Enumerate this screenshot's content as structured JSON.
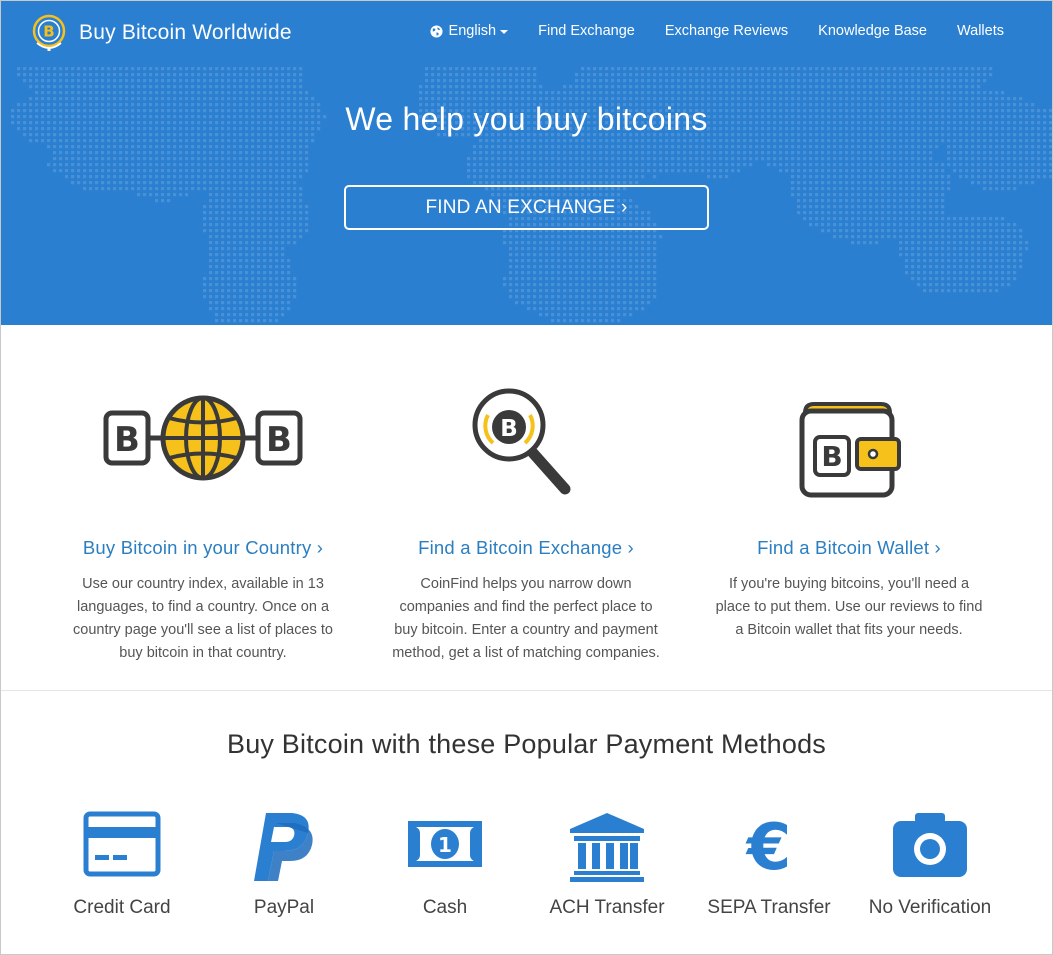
{
  "header": {
    "brand_name": "Buy Bitcoin Worldwide",
    "language": "English",
    "nav": [
      "Find Exchange",
      "Exchange Reviews",
      "Knowledge Base",
      "Wallets"
    ]
  },
  "hero": {
    "title": "We help you buy bitcoins",
    "button": "FIND AN EXCHANGE ›"
  },
  "features": [
    {
      "title": "Buy Bitcoin in your Country ›",
      "desc": [
        "Use our country index, available in 13",
        "languages, to find a country. Once on a",
        "country page you'll see a list of places to",
        "buy bitcoin in that country."
      ]
    },
    {
      "title": "Find a Bitcoin Exchange ›",
      "desc": [
        "CoinFind helps you narrow down",
        "companies and find the perfect place to",
        "buy bitcoin. Enter a country and payment",
        "method, get a list of matching companies."
      ]
    },
    {
      "title": "Find a Bitcoin Wallet ›",
      "desc": [
        "If you're buying bitcoins, you'll need a",
        "place to put them. Use our reviews to find",
        "a Bitcoin wallet that fits your needs."
      ]
    }
  ],
  "payments": {
    "title": "Buy Bitcoin with these Popular Payment Methods",
    "methods": [
      "Credit Card",
      "PayPal",
      "Cash",
      "ACH Transfer",
      "SEPA Transfer",
      "No Verification"
    ]
  },
  "colors": {
    "primary_blue": "#2b7fd1",
    "link_blue": "#2b7fc1",
    "bitcoin_yellow": "#f5c11a",
    "icon_dark": "#3a3a3a"
  }
}
